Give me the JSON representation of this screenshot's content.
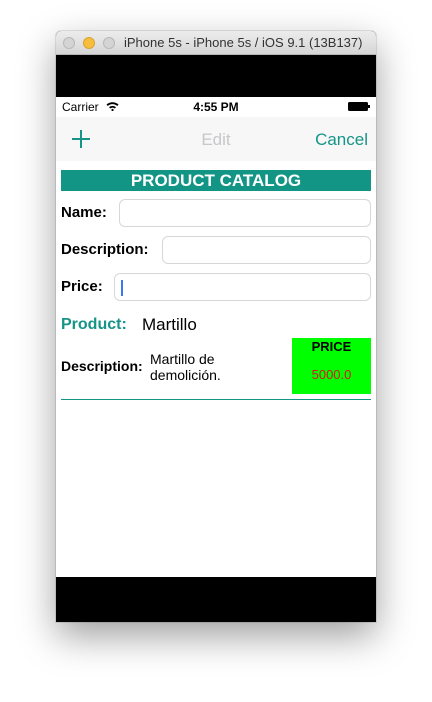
{
  "window": {
    "title": "iPhone 5s - iPhone 5s / iOS 9.1 (13B137)"
  },
  "status_bar": {
    "carrier": "Carrier",
    "time": "4:55 PM"
  },
  "nav_bar": {
    "edit_label": "Edit",
    "cancel_label": "Cancel"
  },
  "header": {
    "title": "PRODUCT CATALOG"
  },
  "form": {
    "name_label": "Name:",
    "name_value": "",
    "description_label": "Description:",
    "description_value": "",
    "price_label": "Price:",
    "price_value": ""
  },
  "product_row": {
    "product_label": "Product:",
    "product_value": "Martillo",
    "description_label": "Description:",
    "description_value": "Martillo de demolición.",
    "price_title": "PRICE",
    "price_value": "5000.0"
  },
  "colors": {
    "accent": "#169488",
    "header_bg": "#129585",
    "price_bg": "#00ff00",
    "price_text": "#e0141a"
  },
  "icons": {
    "add": "add-icon",
    "wifi": "wifi-icon",
    "battery": "battery-icon"
  }
}
